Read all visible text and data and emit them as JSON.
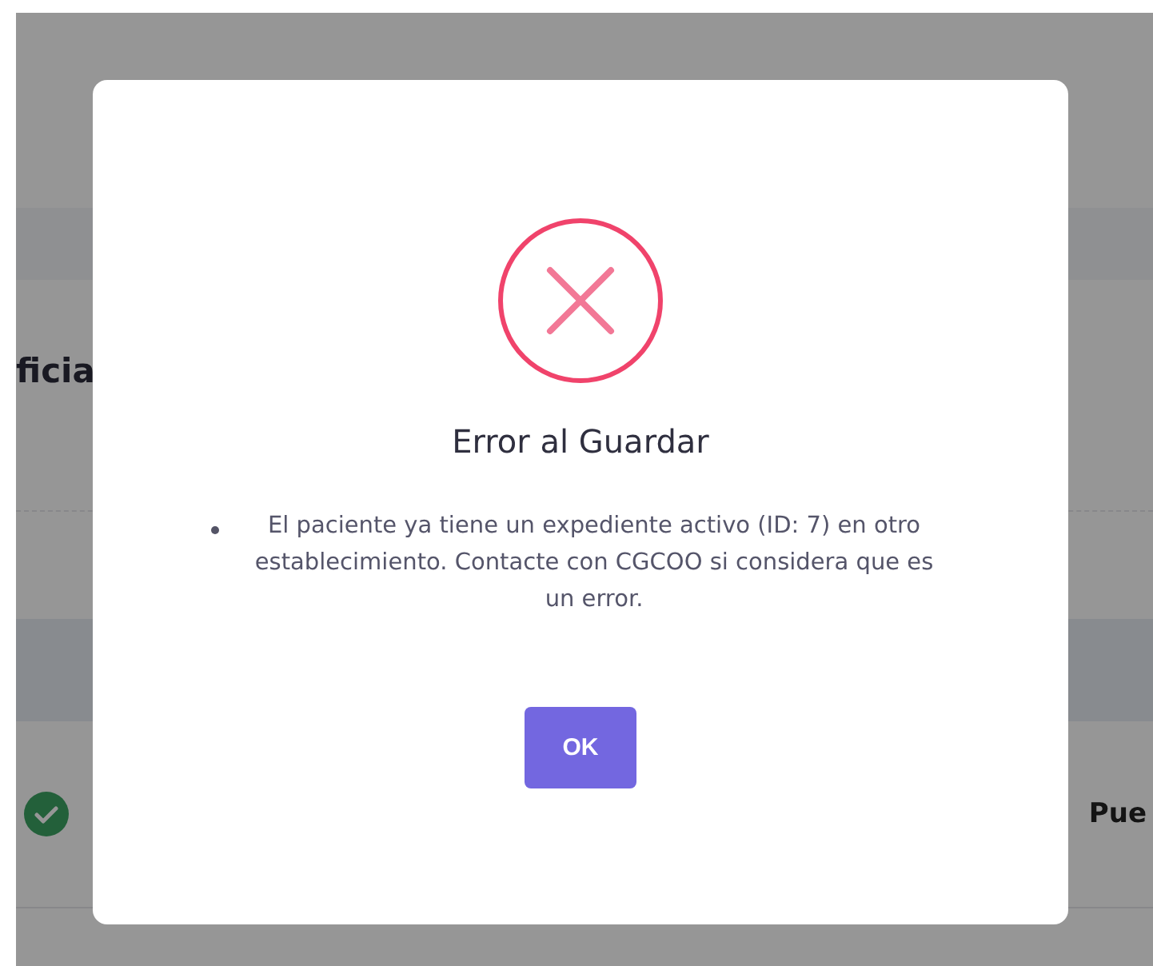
{
  "background": {
    "heading": "ficia",
    "rows": [
      {
        "kind": "success",
        "text": "Pue"
      }
    ]
  },
  "dialog": {
    "kind": "error",
    "title": "Error al Guardar",
    "messages": [
      "El paciente ya tiene un expediente activo (ID: 7) en otro establecimiento. Contacte con CGCOO si considera que es un error."
    ],
    "buttons": [
      "OK"
    ]
  }
}
